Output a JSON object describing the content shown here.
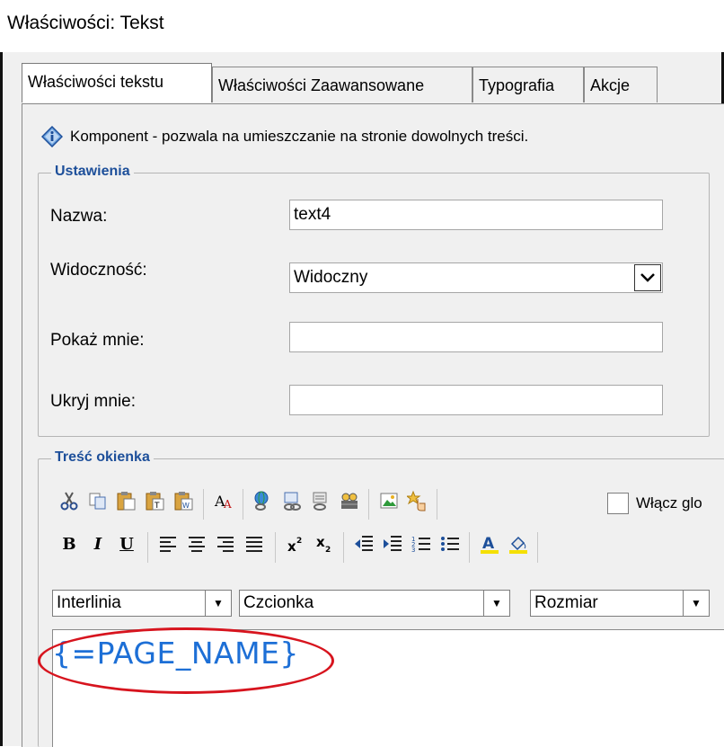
{
  "window": {
    "title": "Właściwości: Tekst"
  },
  "tabs": [
    {
      "label": "Właściwości tekstu"
    },
    {
      "label": "Właściwości Zaawansowane"
    },
    {
      "label": "Typografia"
    },
    {
      "label": "Akcje"
    }
  ],
  "info": {
    "text": "Komponent - pozwala na umieszczanie na stronie dowolnych treści."
  },
  "settings": {
    "legend": "Ustawienia",
    "name_label": "Nazwa:",
    "name_value": "text4",
    "visibility_label": "Widoczność:",
    "visibility_value": "Widoczny",
    "show_label": "Pokaż mnie:",
    "show_value": "",
    "hide_label": "Ukryj mnie:",
    "hide_value": ""
  },
  "content": {
    "legend": "Treść okienka",
    "checkbox_label": "Włącz glo",
    "line_height_combo": "Interlinia",
    "font_combo": "Czcionka",
    "size_combo": "Rozmiar",
    "editor_text": "{=PAGE_NAME}"
  },
  "toolbar1_icons": [
    "scissors-icon",
    "copy-icon",
    "paste-icon",
    "paste-text-icon",
    "paste-word-icon",
    "spellcheck-icon",
    "insert-link-icon",
    "anchor-icon",
    "unlink-icon",
    "insert-table-icon",
    "insert-image-icon",
    "special-char-icon"
  ],
  "toolbar2_icons": [
    "bold-icon",
    "italic-icon",
    "underline-icon",
    "align-left-icon",
    "align-center-icon",
    "align-right-icon",
    "justify-icon",
    "superscript-icon",
    "subscript-icon",
    "outdent-icon",
    "indent-icon",
    "numbered-list-icon",
    "bullet-list-icon",
    "font-color-icon",
    "highlight-color-icon"
  ],
  "colors": {
    "legend_blue": "#1d4f9a",
    "editor_text_blue": "#1d6fd6",
    "highlight_red": "#d7141e"
  }
}
